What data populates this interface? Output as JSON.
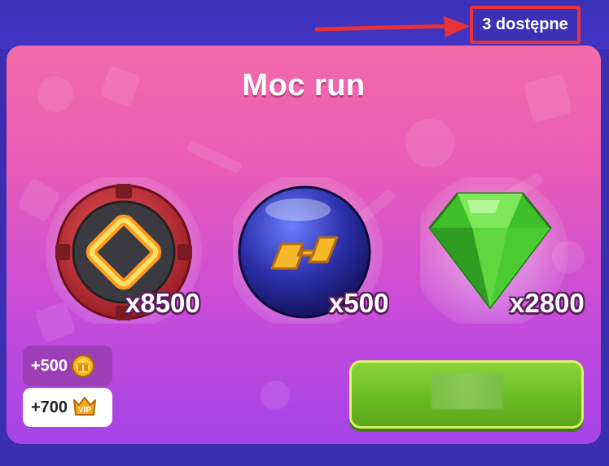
{
  "header": {
    "available_label": "3 dostępne"
  },
  "panel": {
    "title": "Moc run"
  },
  "rewards": [
    {
      "icon": "rune-power-icon",
      "quantity": "x8500"
    },
    {
      "icon": "blue-rune-orb-icon",
      "quantity": "x500"
    },
    {
      "icon": "green-gem-icon",
      "quantity": "x2800"
    }
  ],
  "bonuses": {
    "coins": {
      "text": "+500",
      "icon": "gift-coin-icon"
    },
    "vip": {
      "text": "+700",
      "icon": "vip-badge-icon"
    }
  },
  "buy_button": {
    "label_obscured": true
  },
  "colors": {
    "background": "#3b30b8",
    "panel_top": "#f36aa8",
    "panel_bottom": "#a543e8",
    "highlight_red": "#e8323a",
    "button_green": "#6cbb22"
  }
}
